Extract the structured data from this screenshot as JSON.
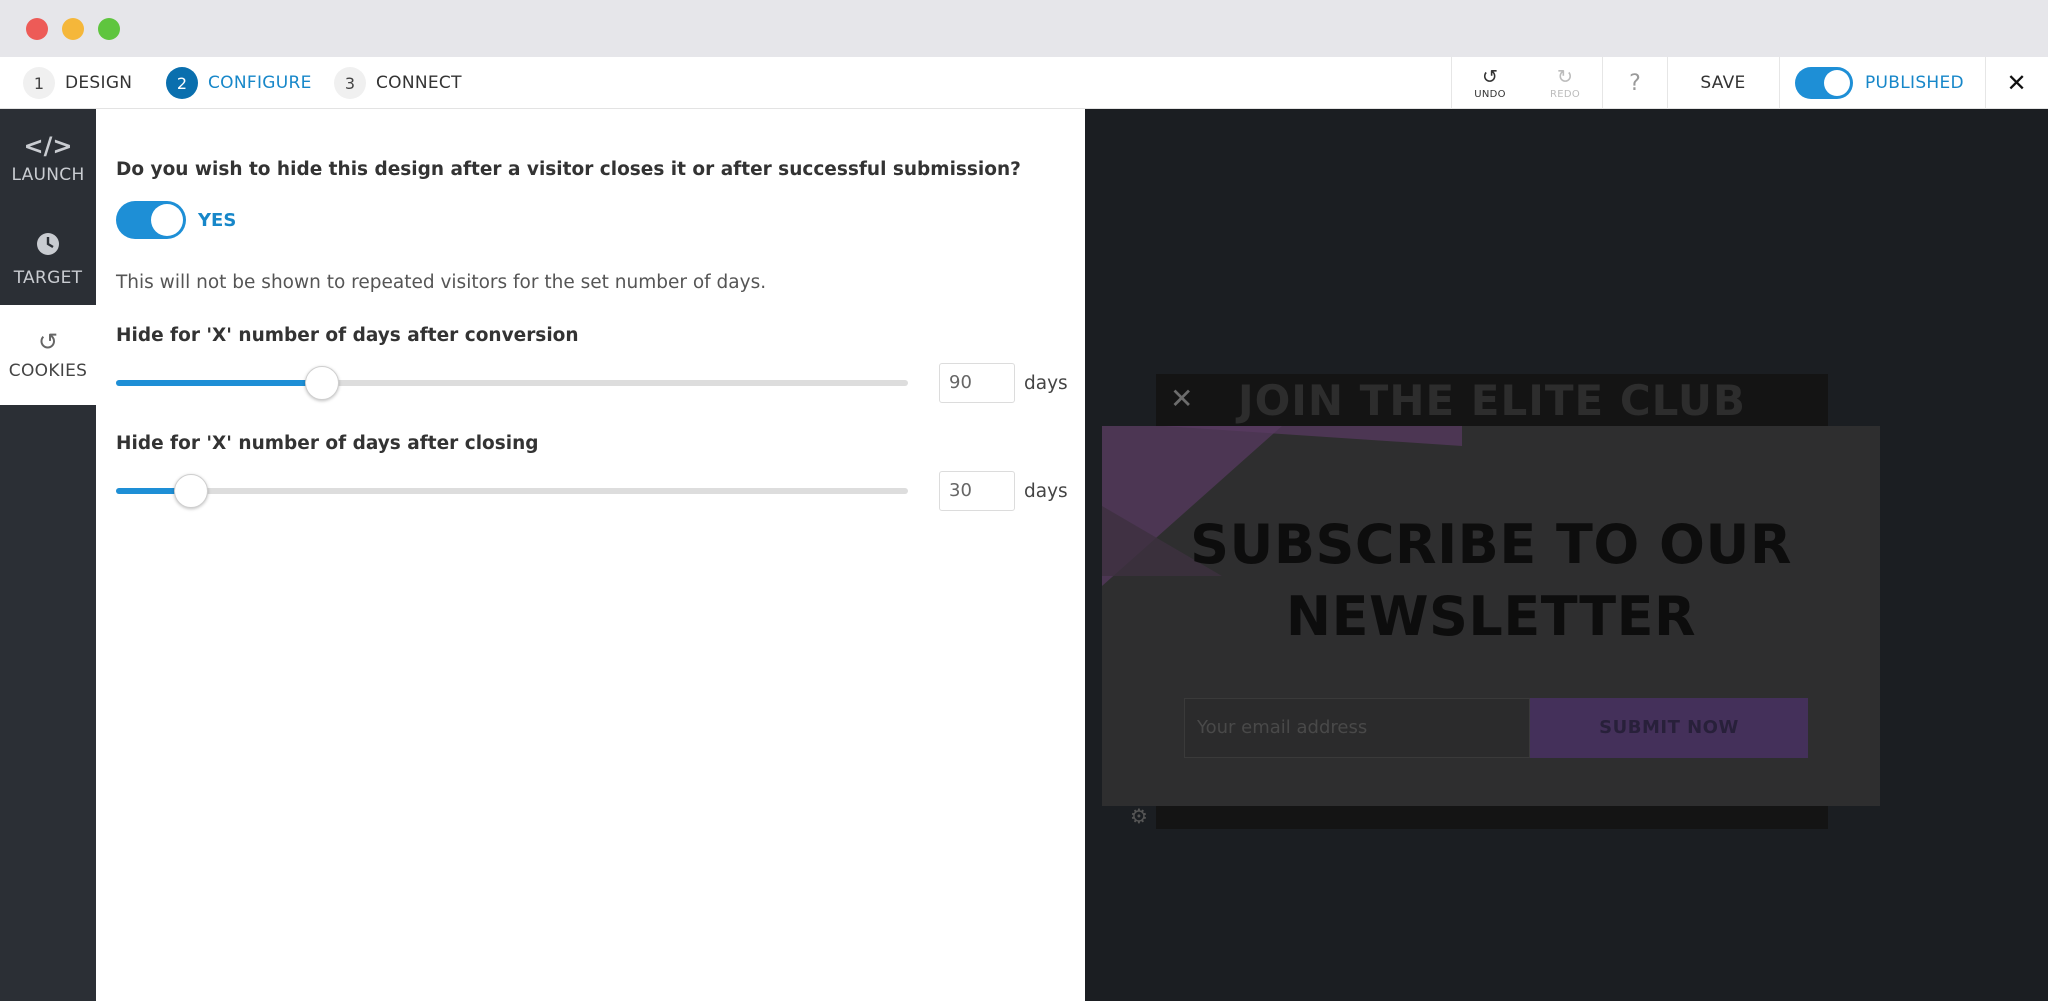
{
  "window": {
    "title": ""
  },
  "steps": [
    {
      "num": "1",
      "label": "DESIGN"
    },
    {
      "num": "2",
      "label": "CONFIGURE"
    },
    {
      "num": "3",
      "label": "CONNECT"
    }
  ],
  "toolbar": {
    "undo_label": "UNDO",
    "redo_label": "REDO",
    "help_label": "?",
    "save_label": "SAVE",
    "published_label": "PUBLISHED",
    "close_label": "✕"
  },
  "leftnav": {
    "launch": {
      "label": "LAUNCH",
      "icon": "</>"
    },
    "target": {
      "label": "TARGET"
    },
    "cookies": {
      "label": "COOKIES"
    }
  },
  "config": {
    "question": "Do you wish to hide this design after a visitor closes it or after successful submission?",
    "toggle_label": "YES",
    "note": "This will not be shown to repeated visitors for the set number of days.",
    "conversion": {
      "label": "Hide for 'X' number of days after conversion",
      "value": "90",
      "unit": "days",
      "fraction": 0.26
    },
    "closing": {
      "label": "Hide for 'X' number of days after closing",
      "value": "30",
      "unit": "days",
      "fraction": 0.095
    }
  },
  "preview": {
    "back_title": "JOIN THE ELITE CLUB",
    "title_line1": "SUBSCRIBE TO OUR",
    "title_line2": "NEWSLETTER",
    "email_placeholder": "Your email address",
    "submit_label": "SUBMIT NOW"
  }
}
